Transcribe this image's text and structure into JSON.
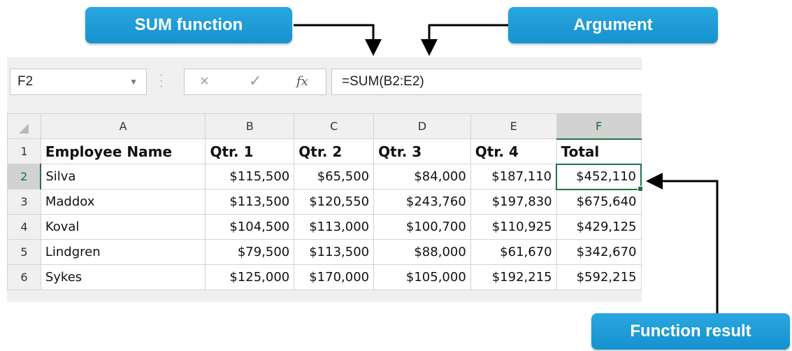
{
  "callouts": {
    "sum_function": "SUM function",
    "argument": "Argument",
    "function_result": "Function result"
  },
  "formula_bar": {
    "name_box": "F2",
    "cancel_icon": "×",
    "enter_icon": "✓",
    "fx_icon": "fx",
    "formula": "=SUM(B2:E2)"
  },
  "columns": [
    "A",
    "B",
    "C",
    "D",
    "E",
    "F"
  ],
  "rows": [
    {
      "row": "1",
      "cells": [
        "Employee Name",
        "Qtr. 1",
        "Qtr. 2",
        "Qtr. 3",
        "Qtr. 4",
        "Total"
      ]
    },
    {
      "row": "2",
      "cells": [
        "Silva",
        "$115,500",
        "$65,500",
        "$84,000",
        "$187,110",
        "$452,110"
      ]
    },
    {
      "row": "3",
      "cells": [
        "Maddox",
        "$113,500",
        "$120,550",
        "$243,760",
        "$197,830",
        "$675,640"
      ]
    },
    {
      "row": "4",
      "cells": [
        "Koval",
        "$104,500",
        "$113,000",
        "$100,700",
        "$110,925",
        "$429,125"
      ]
    },
    {
      "row": "5",
      "cells": [
        "Lindgren",
        "$79,500",
        "$113,500",
        "$88,000",
        "$61,670",
        "$342,670"
      ]
    },
    {
      "row": "6",
      "cells": [
        "Sykes",
        "$125,000",
        "$170,000",
        "$105,000",
        "$192,215",
        "$592,215"
      ]
    }
  ],
  "colors": {
    "callout": "#1a9ad6",
    "selection": "#217346"
  }
}
